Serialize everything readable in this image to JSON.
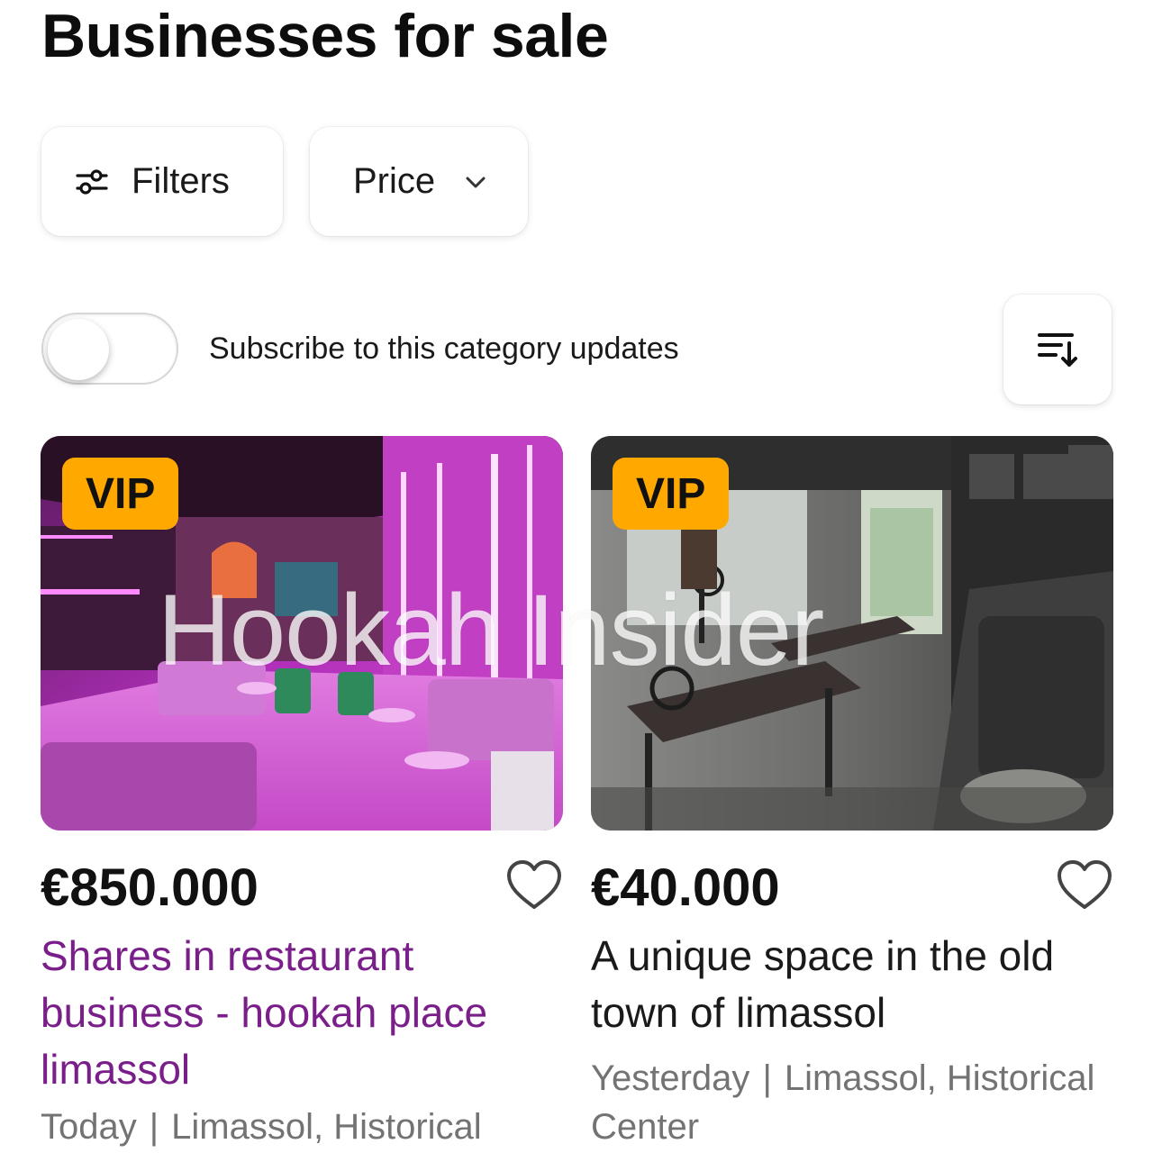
{
  "header": {
    "title": "Businesses for sale"
  },
  "filters": {
    "filters_label": "Filters",
    "filters_icon": "sliders-icon",
    "price_label": "Price",
    "price_icon": "chevron-down-icon"
  },
  "subscribe": {
    "label": "Subscribe to this category updates",
    "enabled": false
  },
  "sort": {
    "icon": "sort-icon"
  },
  "listings": [
    {
      "badge": "VIP",
      "price": "€850.000",
      "title": "Shares in restaurant business - hookah place limassol",
      "date": "Today",
      "location": "Limassol, Historical",
      "image": "pink-neon-lounge-photo",
      "favorite_icon": "heart-outline-icon"
    },
    {
      "badge": "VIP",
      "price": "€40.000",
      "title": "A unique space in the old town of limassol",
      "date": "Yesterday",
      "location": "Limassol, Historical Center",
      "image": "dark-cafe-interior-photo",
      "favorite_icon": "heart-outline-icon"
    }
  ],
  "watermark": "Hookah Insider",
  "colors": {
    "vip": "#ffa900",
    "title_link": "#7a1f8a",
    "meta": "#737373"
  }
}
